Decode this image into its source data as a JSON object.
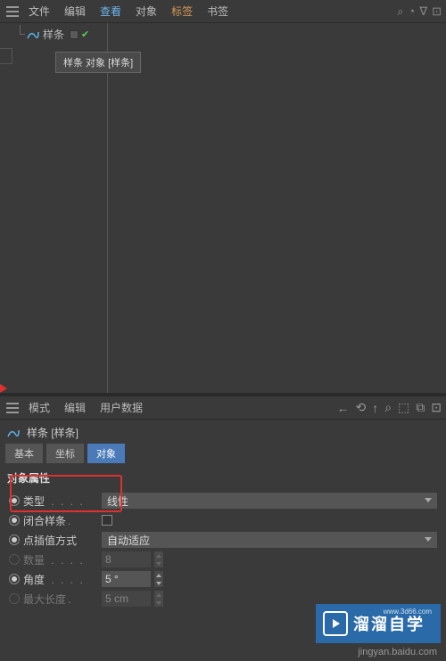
{
  "topMenu": {
    "file": "文件",
    "edit": "编辑",
    "view": "查看",
    "object": "对象",
    "tags": "标签",
    "bookmark": "书签"
  },
  "tree": {
    "item": "样条",
    "tooltip": "样条 对象 [样条]"
  },
  "attrMenu": {
    "mode": "模式",
    "edit": "编辑",
    "userData": "用户数据"
  },
  "objHeader": "样条 [样条]",
  "tabs": {
    "basic": "基本",
    "coord": "坐标",
    "object": "对象"
  },
  "section": "对象属性",
  "props": {
    "type": {
      "label": "类型",
      "value": "线性"
    },
    "close": {
      "label": "闭合样条"
    },
    "interp": {
      "label": "点插值方式",
      "value": "自动适应"
    },
    "count": {
      "label": "数量",
      "value": "8"
    },
    "angle": {
      "label": "角度",
      "value": "5 °"
    },
    "maxlen": {
      "label": "最大长度",
      "value": "5 cm"
    }
  },
  "watermark": {
    "text": "溜溜自学",
    "url": "www.3d66.com"
  },
  "source": "jingyan.baidu.com"
}
